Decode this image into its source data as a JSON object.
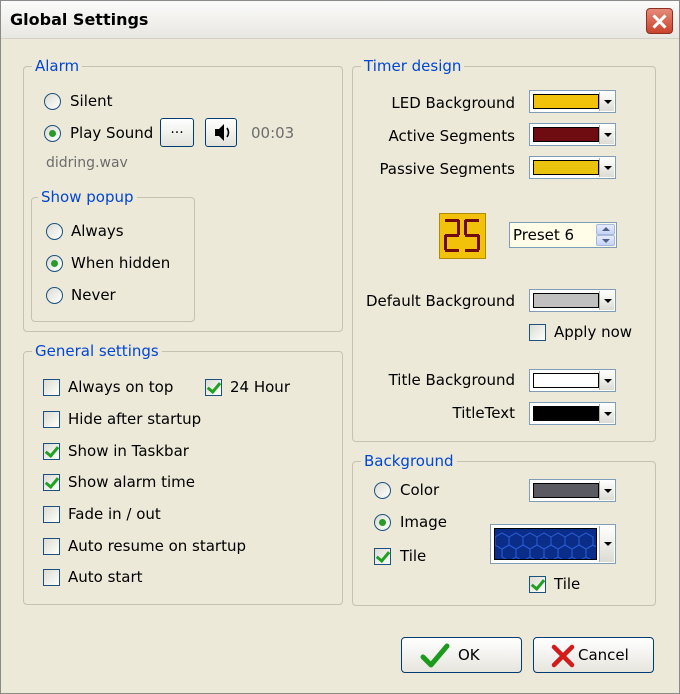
{
  "window": {
    "title": "Global Settings"
  },
  "alarm": {
    "legend": "Alarm",
    "silent_label": "Silent",
    "play_sound_label": "Play Sound",
    "browse_label": "...",
    "duration": "00:03",
    "filename": "didring.wav",
    "selected": "Play Sound"
  },
  "popup": {
    "legend": "Show popup",
    "options": [
      "Always",
      "When hidden",
      "Never"
    ],
    "selected": "When hidden"
  },
  "general": {
    "legend": "General settings",
    "items": [
      {
        "label": "Always on top",
        "checked": false
      },
      {
        "label": "24 Hour",
        "checked": true
      },
      {
        "label": "Hide after startup",
        "checked": false
      },
      {
        "label": "Show in Taskbar",
        "checked": true
      },
      {
        "label": "Show alarm time",
        "checked": true
      },
      {
        "label": "Fade in / out",
        "checked": false
      },
      {
        "label": "Auto resume on startup",
        "checked": false
      },
      {
        "label": "Auto start",
        "checked": false
      }
    ]
  },
  "timer_design": {
    "legend": "Timer design",
    "led_background_label": "LED Background",
    "led_background_color": "#f2c20b",
    "active_segments_label": "Active Segments",
    "active_segments_color": "#6e0c12",
    "passive_segments_label": "Passive Segments",
    "passive_segments_color": "#e9c30e",
    "preview_digits": "25",
    "preset_value": "Preset 6",
    "default_background_label": "Default Background",
    "default_background_color": "#c0c0c0",
    "apply_now_label": "Apply now",
    "apply_now_checked": false,
    "title_background_label": "Title Background",
    "title_background_color": "#ffffff",
    "title_text_label": "TitleText",
    "title_text_color": "#000000"
  },
  "background": {
    "legend": "Background",
    "color_label": "Color",
    "color_value": "#5a5a63",
    "image_label": "Image",
    "selected": "Image",
    "tile_label": "Tile",
    "tile_checked": true,
    "image_tile_label": "Tile",
    "image_tile_checked": true
  },
  "buttons": {
    "ok_label": "OK",
    "cancel_label": "Cancel"
  }
}
